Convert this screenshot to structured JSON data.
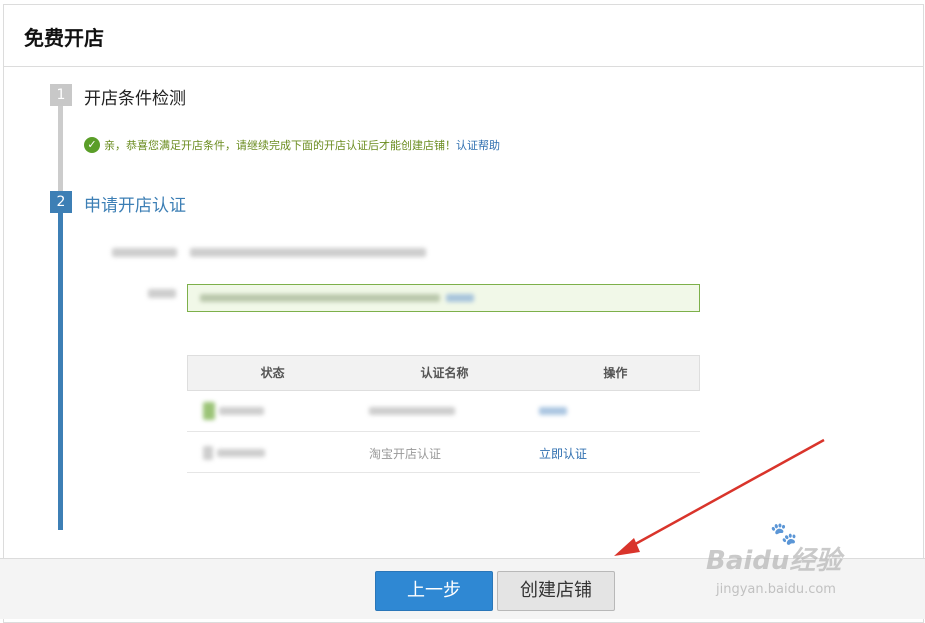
{
  "header": {
    "title": "免费开店"
  },
  "steps": [
    {
      "number": "1",
      "title": "开店条件检测"
    },
    {
      "number": "2",
      "title": "申请开店认证"
    }
  ],
  "notice": {
    "text": "亲，恭喜您满足开店条件，请继续完成下面的开店认证后才能创建店铺！",
    "link": "认证帮助"
  },
  "table": {
    "headers": [
      "状态",
      "认证名称",
      "操作"
    ],
    "rows": [
      {
        "status": "",
        "name": "",
        "action": ""
      },
      {
        "status": "",
        "name": "淘宝开店认证",
        "action": "立即认证"
      }
    ]
  },
  "footer": {
    "prev_label": "上一步",
    "create_label": "创建店铺"
  },
  "watermark": {
    "logo": "Baidu经验",
    "url": "jingyan.baidu.com"
  },
  "colors": {
    "accent": "#3d7fb5",
    "success": "#5a9e28",
    "primary_button": "#2f88d3",
    "annotation_arrow": "#d9342b"
  }
}
